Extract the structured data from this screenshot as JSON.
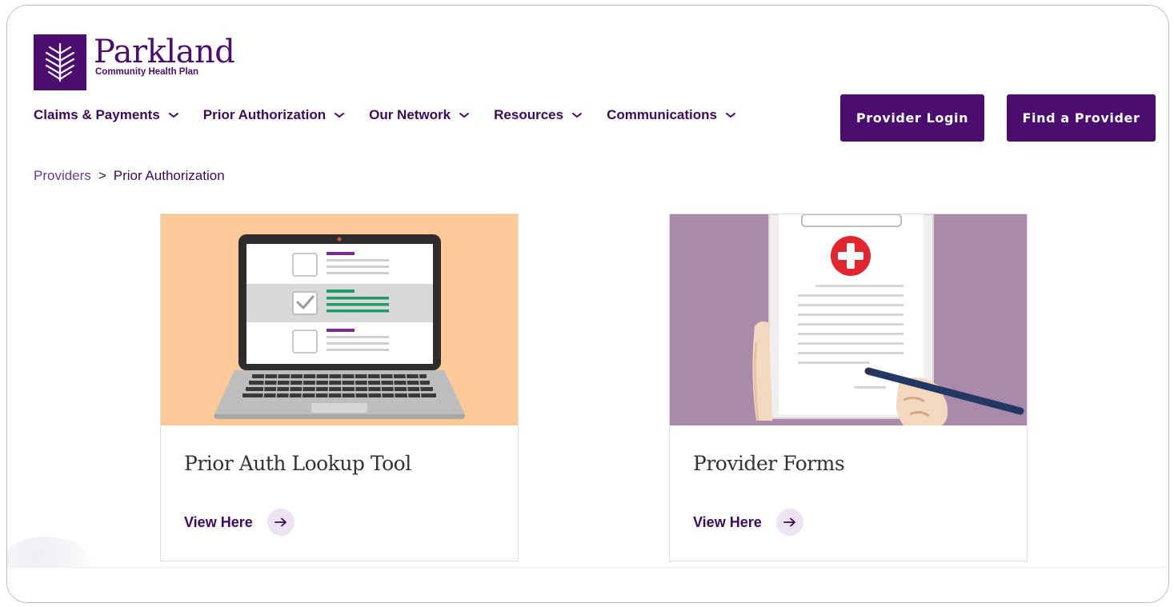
{
  "brand": {
    "name": "Parkland",
    "subtitle": "Community Health Plan",
    "color": "#4b0d6e"
  },
  "nav": {
    "items": [
      {
        "label": "Claims & Payments"
      },
      {
        "label": "Prior Authorization"
      },
      {
        "label": "Our Network"
      },
      {
        "label": "Resources"
      },
      {
        "label": "Communications"
      }
    ],
    "provider_login": "Provider Login",
    "find_provider": "Find a Provider"
  },
  "breadcrumb": {
    "parent": "Providers",
    "separator": ">",
    "current": "Prior Authorization"
  },
  "cards": [
    {
      "title": "Prior Auth Lookup Tool",
      "link_label": "View Here",
      "icon": "laptop-checklist-illustration"
    },
    {
      "title": "Provider Forms",
      "link_label": "View Here",
      "icon": "clipboard-medical-form-illustration"
    }
  ],
  "colors": {
    "accent": "#4b0d6e",
    "card1_bg": "#fdc998",
    "card2_bg": "#a98aab",
    "arrow_bg": "#ece4f2"
  }
}
